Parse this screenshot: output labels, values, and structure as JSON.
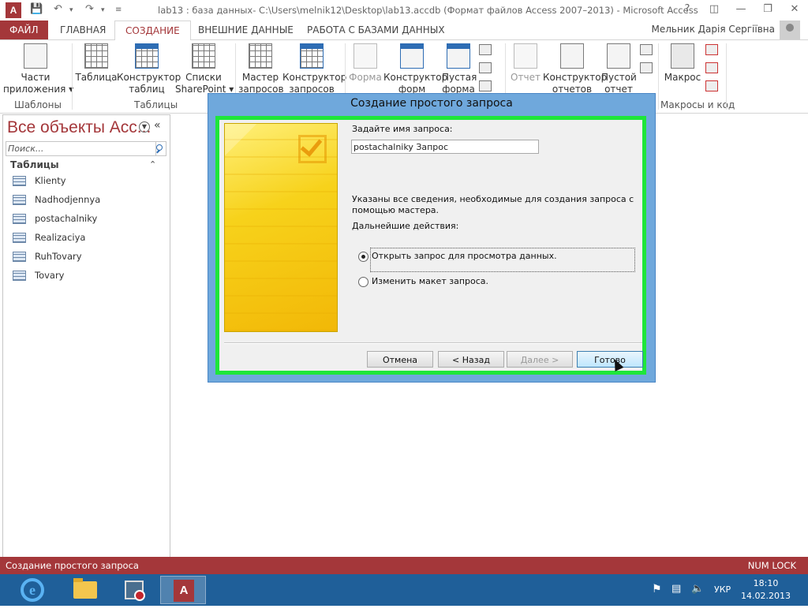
{
  "window": {
    "title": "lab13 : база данных- C:\\Users\\melnik12\\Desktop\\lab13.accdb (Формат файлов Access 2007–2013) - Microsoft Access",
    "app_icon": "A",
    "user_name": "Мельник Дарія Сергіївна"
  },
  "ribbon": {
    "tabs": [
      "ФАЙЛ",
      "ГЛАВНАЯ",
      "СОЗДАНИЕ",
      "ВНЕШНИЕ ДАННЫЕ",
      "РАБОТА С БАЗАМИ ДАННЫХ"
    ],
    "active_tab": "СОЗДАНИЕ",
    "buttons": {
      "app_parts": "Части\nприложения ▾",
      "table": "Таблица",
      "table_designer": "Конструктор\nтаблиц",
      "sharepoint_lists": "Списки\nSharePoint ▾",
      "query_wizard": "Мастер\nзапросов",
      "query_designer": "Конструктор\nзапросов",
      "form": "Форма",
      "form_designer": "Конструктор\nформ",
      "blank_form": "Пустая\nформа",
      "report": "Отчет",
      "report_designer": "Конструктор\nотчетов",
      "blank_report": "Пустой\nотчет",
      "macro": "Макрос"
    },
    "groups": {
      "templates": "Шаблоны",
      "tables": "Таблицы",
      "macros_code": "Макросы и код"
    }
  },
  "nav": {
    "title": "Все объекты Acc...",
    "search_placeholder": "Поиск...",
    "section": "Таблицы",
    "items": [
      "Klienty",
      "Nadhodjennya",
      "postachalniky",
      "Realizaciya",
      "RuhTovary",
      "Tovary"
    ]
  },
  "dialog": {
    "title": "Создание простого запроса",
    "name_prompt": "Задайте имя запроса:",
    "name_value": "postachalniky Запрос",
    "info_text_1": "Указаны все сведения, необходимые для создания запроса с",
    "info_text_2": "помощью мастера.",
    "next_actions": "Дальнейшие действия:",
    "option_open": "Открыть запрос для просмотра данных.",
    "option_modify": "Изменить макет запроса.",
    "selected_option": "open",
    "buttons": {
      "cancel": "Отмена",
      "back": "< Назад",
      "next": "Далее >",
      "finish": "Готово"
    }
  },
  "status": {
    "left": "Создание простого запроса",
    "right": "NUM LOCK"
  },
  "taskbar": {
    "language": "УКР",
    "time": "18:10",
    "date": "14.02.2013"
  },
  "colors": {
    "access_brand": "#a4373a",
    "dialog_frame": "#6fa8dc",
    "highlight_border": "#1ee63a",
    "taskbar": "#1f5f99"
  }
}
